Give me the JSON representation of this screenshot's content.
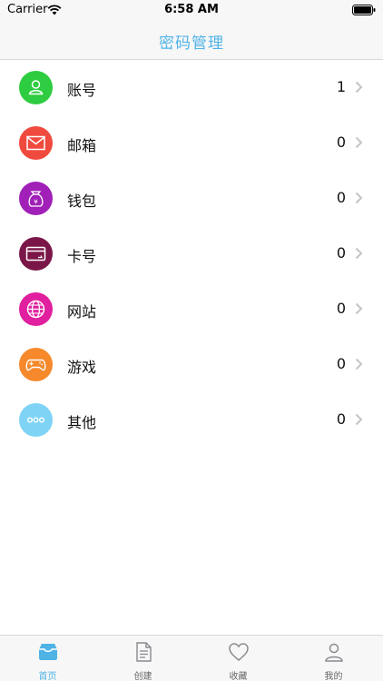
{
  "status_bar": {
    "carrier": "Carrier",
    "time": "6:58 AM"
  },
  "nav": {
    "title": "密码管理"
  },
  "categories": [
    {
      "label": "账号",
      "count": "1",
      "icon": "user-icon",
      "color": "#2ecc40"
    },
    {
      "label": "邮箱",
      "count": "0",
      "icon": "mail-icon",
      "color": "#f04a3e"
    },
    {
      "label": "钱包",
      "count": "0",
      "icon": "wallet-icon",
      "color": "#a020b8"
    },
    {
      "label": "卡号",
      "count": "0",
      "icon": "card-icon",
      "color": "#7a1748"
    },
    {
      "label": "网站",
      "count": "0",
      "icon": "globe-icon",
      "color": "#e0209e"
    },
    {
      "label": "游戏",
      "count": "0",
      "icon": "gamepad-icon",
      "color": "#f5892b"
    },
    {
      "label": "其他",
      "count": "0",
      "icon": "more-icon",
      "color": "#7fd3f5"
    }
  ],
  "tabs": [
    {
      "label": "首页",
      "icon": "inbox-icon",
      "active": true
    },
    {
      "label": "创建",
      "icon": "document-icon",
      "active": false
    },
    {
      "label": "收藏",
      "icon": "heart-icon",
      "active": false
    },
    {
      "label": "我的",
      "icon": "person-icon",
      "active": false
    }
  ],
  "colors": {
    "accent": "#4fb3e6",
    "bar_bg": "#f7f7f7"
  }
}
